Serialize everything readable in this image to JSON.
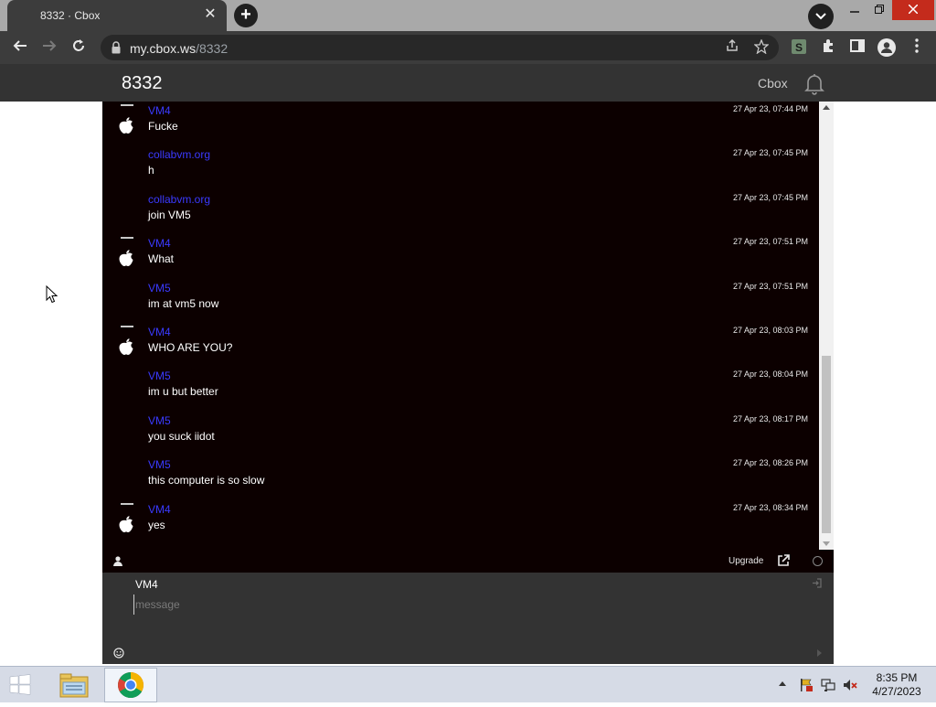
{
  "browser": {
    "tab_title": "8332 · Cbox",
    "tab_close": "✕",
    "new_tab": "+",
    "url_host": "my.cbox.ws",
    "url_path": "/8332"
  },
  "site": {
    "title": "8332",
    "brand": "Cbox"
  },
  "messages": [
    {
      "user": "VM4",
      "text": "Fucke",
      "time": "27 Apr 23, 07:44 PM",
      "avatar": true
    },
    {
      "user": "collabvm.org",
      "text": "h",
      "time": "27 Apr 23, 07:45 PM",
      "avatar": false
    },
    {
      "user": "collabvm.org",
      "text": "join VM5",
      "time": "27 Apr 23, 07:45 PM",
      "avatar": false
    },
    {
      "user": "VM4",
      "text": "What",
      "time": "27 Apr 23, 07:51 PM",
      "avatar": true
    },
    {
      "user": "VM5",
      "text": "im at vm5 now",
      "time": "27 Apr 23, 07:51 PM",
      "avatar": false
    },
    {
      "user": "VM4",
      "text": "WHO ARE YOU?",
      "time": "27 Apr 23, 08:03 PM",
      "avatar": true
    },
    {
      "user": "VM5",
      "text": "im u but better",
      "time": "27 Apr 23, 08:04 PM",
      "avatar": false
    },
    {
      "user": "VM5",
      "text": "you suck iidot",
      "time": "27 Apr 23, 08:17 PM",
      "avatar": false
    },
    {
      "user": "VM5",
      "text": "this computer is so slow",
      "time": "27 Apr 23, 08:26 PM",
      "avatar": false
    },
    {
      "user": "VM4",
      "text": "yes",
      "time": "27 Apr 23, 08:34 PM",
      "avatar": true
    }
  ],
  "chat_bar": {
    "upgrade_label": "Upgrade"
  },
  "post": {
    "name": "VM4",
    "message_placeholder": "message"
  },
  "taskbar": {
    "time": "8:35 PM",
    "date": "4/27/2023"
  },
  "colors": {
    "chat_background": "#0c0000",
    "username": "#3a3aff",
    "header": "#333333"
  },
  "icons": [
    "apple-icon",
    "bell-icon",
    "lock-icon",
    "star-icon",
    "share-icon",
    "extensions-icon",
    "profile-icon",
    "emoji-icon",
    "popout-icon",
    "windows-start-icon",
    "chrome-icon",
    "file-explorer-icon"
  ]
}
